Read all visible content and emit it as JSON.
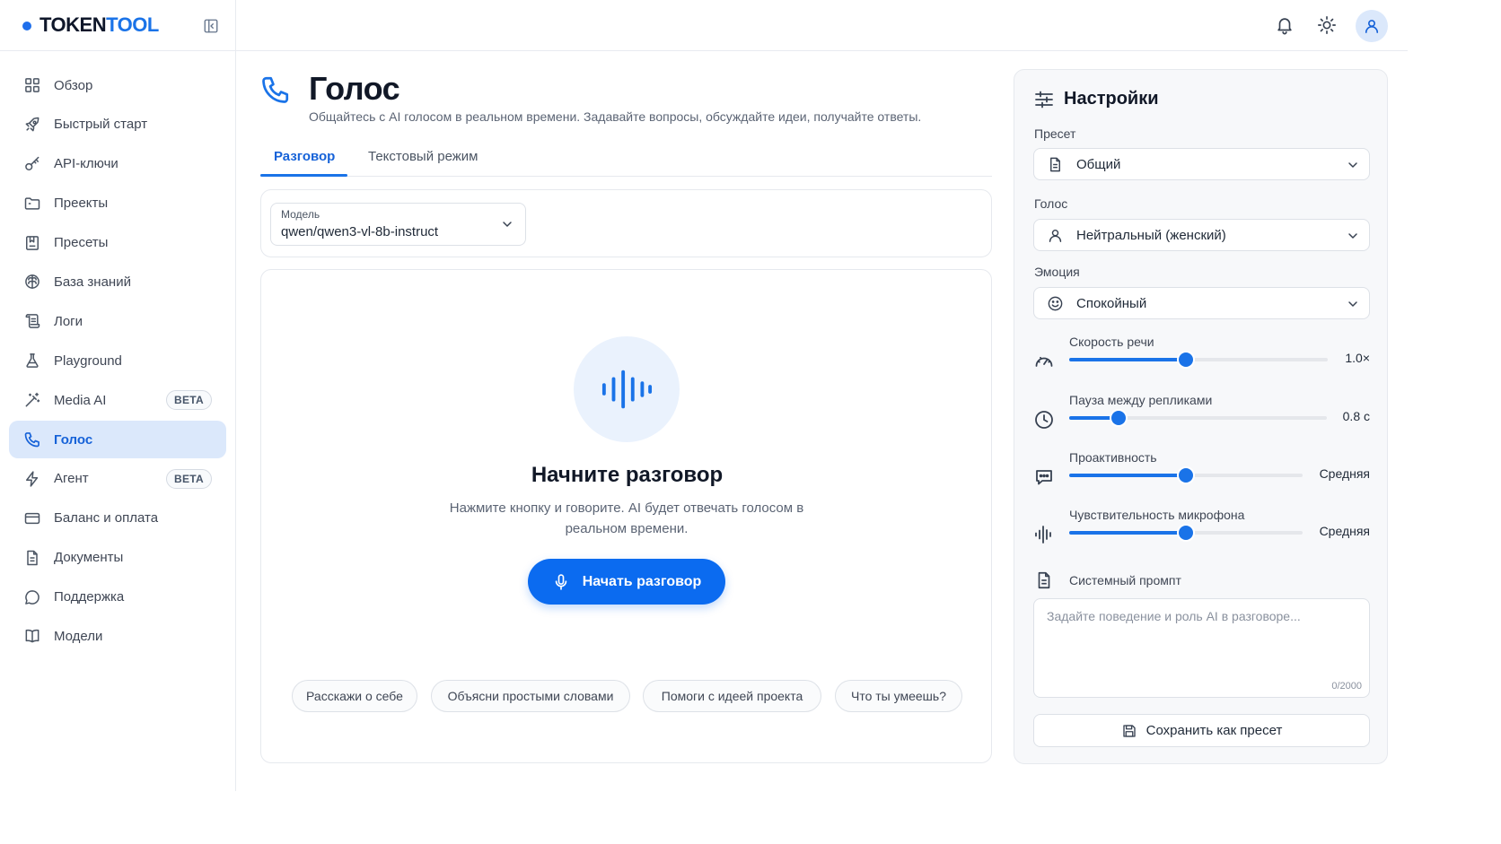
{
  "brand": {
    "name_part1": "TOKEN",
    "name_part2": "TOOL"
  },
  "sidebar": {
    "items": [
      {
        "label": "Обзор",
        "icon": "grid-icon"
      },
      {
        "label": "Быстрый старт",
        "icon": "rocket-icon"
      },
      {
        "label": "API-ключи",
        "icon": "key-icon"
      },
      {
        "label": "Преекты",
        "icon": "folder-icon"
      },
      {
        "label": "Пресеты",
        "icon": "bookmark-icon"
      },
      {
        "label": "База знаний",
        "icon": "brain-icon"
      },
      {
        "label": "Логи",
        "icon": "scroll-icon"
      },
      {
        "label": "Playground",
        "icon": "flask-icon"
      },
      {
        "label": "Media AI",
        "icon": "wand-icon",
        "badge": "BETA"
      },
      {
        "label": "Голос",
        "icon": "phone-icon",
        "active": true
      },
      {
        "label": "Агент",
        "icon": "bolt-icon",
        "badge": "BETA"
      },
      {
        "label": "Баланс и оплата",
        "icon": "card-icon"
      },
      {
        "label": "Документы",
        "icon": "document-icon"
      },
      {
        "label": "Поддержка",
        "icon": "chat-bubble-icon"
      },
      {
        "label": "Модели",
        "icon": "book-icon"
      }
    ]
  },
  "header": {
    "icons": [
      "bell-icon",
      "sun-icon",
      "user-icon"
    ]
  },
  "page": {
    "title": "Голос",
    "subtitle": "Общайтесь с AI голосом в реальном времени. Задавайте вопросы, обсуждайте идеи, получайте ответы."
  },
  "tabs": [
    {
      "label": "Разговор",
      "active": true
    },
    {
      "label": "Текстовый режим",
      "active": false
    }
  ],
  "model": {
    "label": "Модель",
    "value": "qwen/qwen3-vl-8b-instruct"
  },
  "conversation": {
    "title": "Начните разговор",
    "description": "Нажмите кнопку и говорите. AI будет отвечать голосом в реальном времени.",
    "start_button": "Начать разговор",
    "suggestions": [
      "Расскажи о себе",
      "Объясни простыми словами",
      "Помоги с идеей проекта",
      "Что ты умеешь?"
    ]
  },
  "settings": {
    "title": "Настройки",
    "preset": {
      "label": "Пресет",
      "value": "Общий"
    },
    "voice": {
      "label": "Голос",
      "value": "Нейтральный (женский)"
    },
    "emotion": {
      "label": "Эмоция",
      "value": "Спокойный"
    },
    "sliders": [
      {
        "label": "Скорость речи",
        "value_text": "1.0×",
        "fraction": 0.45
      },
      {
        "label": "Пауза между репликами",
        "value_text": "0.8 с",
        "fraction": 0.19
      },
      {
        "label": "Проактивность",
        "value_text": "Средняя",
        "fraction": 0.5
      },
      {
        "label": "Чувствительность микрофона",
        "value_text": "Средняя",
        "fraction": 0.5
      }
    ],
    "system_prompt": {
      "label": "Системный промпт",
      "placeholder": "Задайте поведение и роль AI в разговоре...",
      "counter": "0/2000"
    },
    "save_button": "Сохранить как пресет"
  },
  "colors": {
    "accent": "#1a73e8",
    "active_bg": "#dbe8fb",
    "button": "#0b6bf0"
  }
}
